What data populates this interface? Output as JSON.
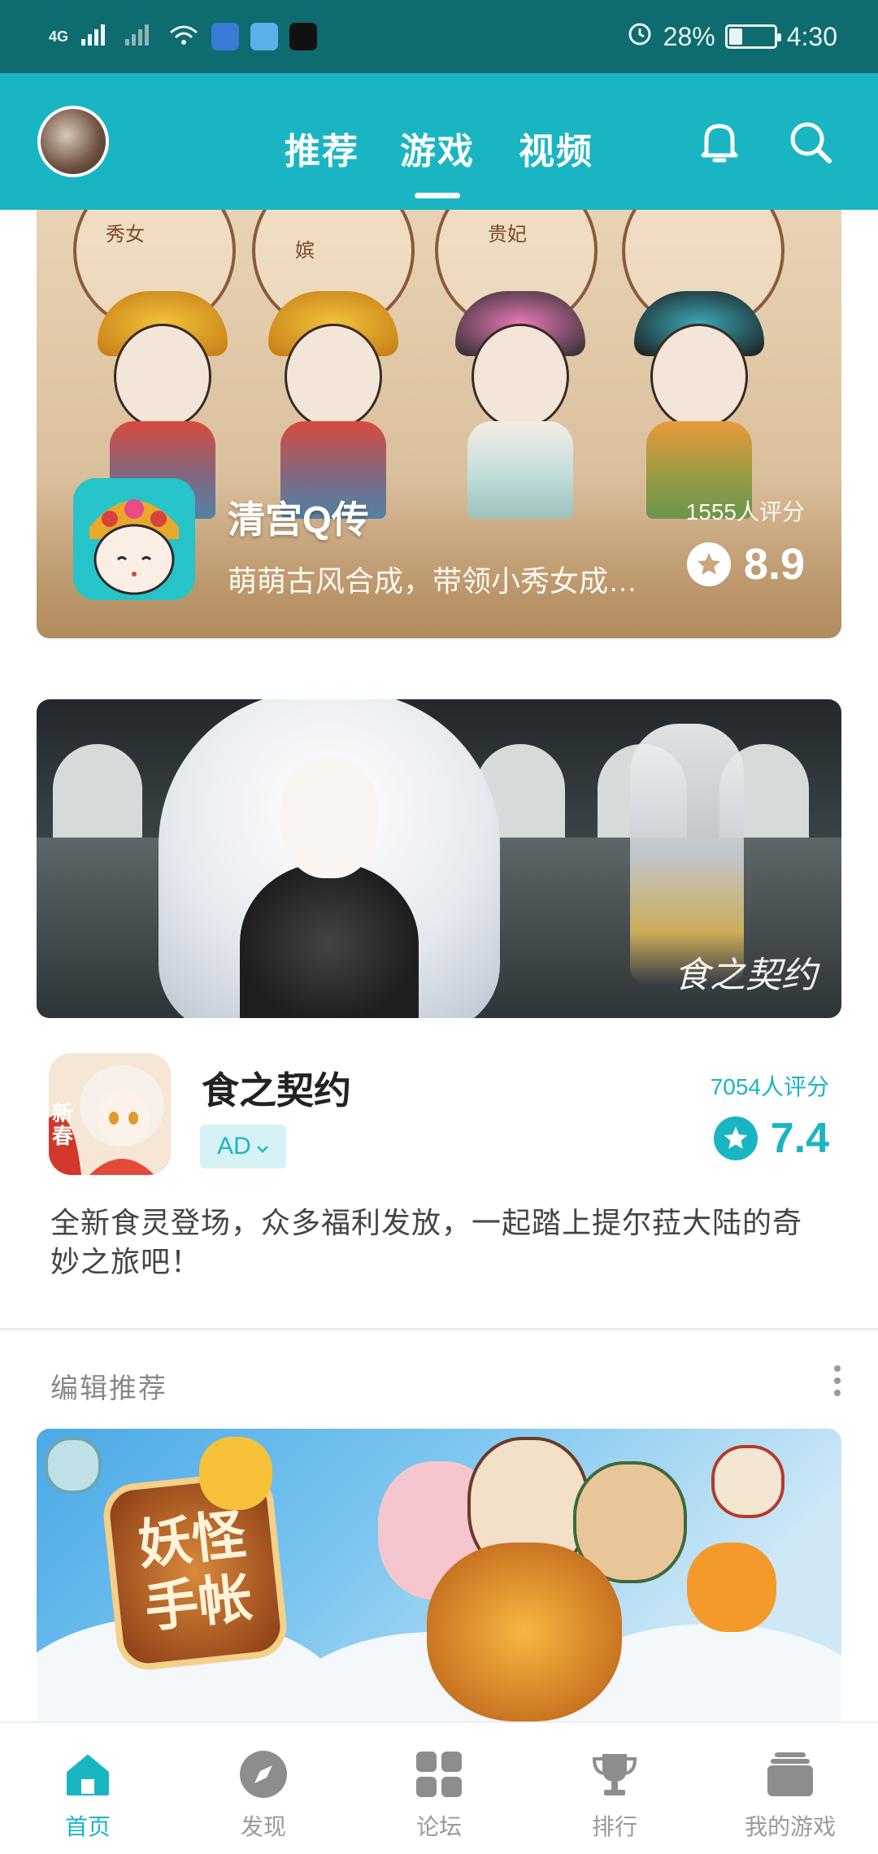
{
  "status_bar": {
    "network": "4G",
    "battery": "28%",
    "battery_level": 0.28,
    "time": "4:30"
  },
  "header": {
    "tabs": [
      {
        "label": "推荐",
        "active": false
      },
      {
        "label": "游戏",
        "active": true
      },
      {
        "label": "视频",
        "active": false
      }
    ],
    "icons": [
      "bell-icon",
      "search-icon"
    ]
  },
  "featured_1": {
    "title": "清宫Q传",
    "description": "萌萌古风合成，带领小秀女成…",
    "rating_count": "1555人评分",
    "score": "8.9",
    "medallion_labels": [
      "秀女",
      "嫔",
      "贵妃"
    ]
  },
  "featured_2": {
    "logo_text": "食之契约"
  },
  "ad_card": {
    "title": "食之契约",
    "badge": "AD",
    "rating_count": "7054人评分",
    "score": "7.4",
    "description": "全新食灵登场，众多福利发放，一起踏上提尔菈大陆的奇妙之旅吧！",
    "icon_label": "新春"
  },
  "section": {
    "title": "编辑推荐"
  },
  "featured_3": {
    "logo_line1": "妖怪",
    "logo_line2": "手帐"
  },
  "bottom_nav": [
    {
      "label": "首页",
      "icon": "home-icon",
      "active": true
    },
    {
      "label": "发现",
      "icon": "compass-icon",
      "active": false
    },
    {
      "label": "论坛",
      "icon": "grid-icon",
      "active": false
    },
    {
      "label": "排行",
      "icon": "trophy-icon",
      "active": false
    },
    {
      "label": "我的游戏",
      "icon": "game-library-icon",
      "active": false
    }
  ],
  "colors": {
    "accent": "#1ab5c2",
    "status_bar": "#0e6b6f",
    "inactive": "#9a9a9a"
  }
}
